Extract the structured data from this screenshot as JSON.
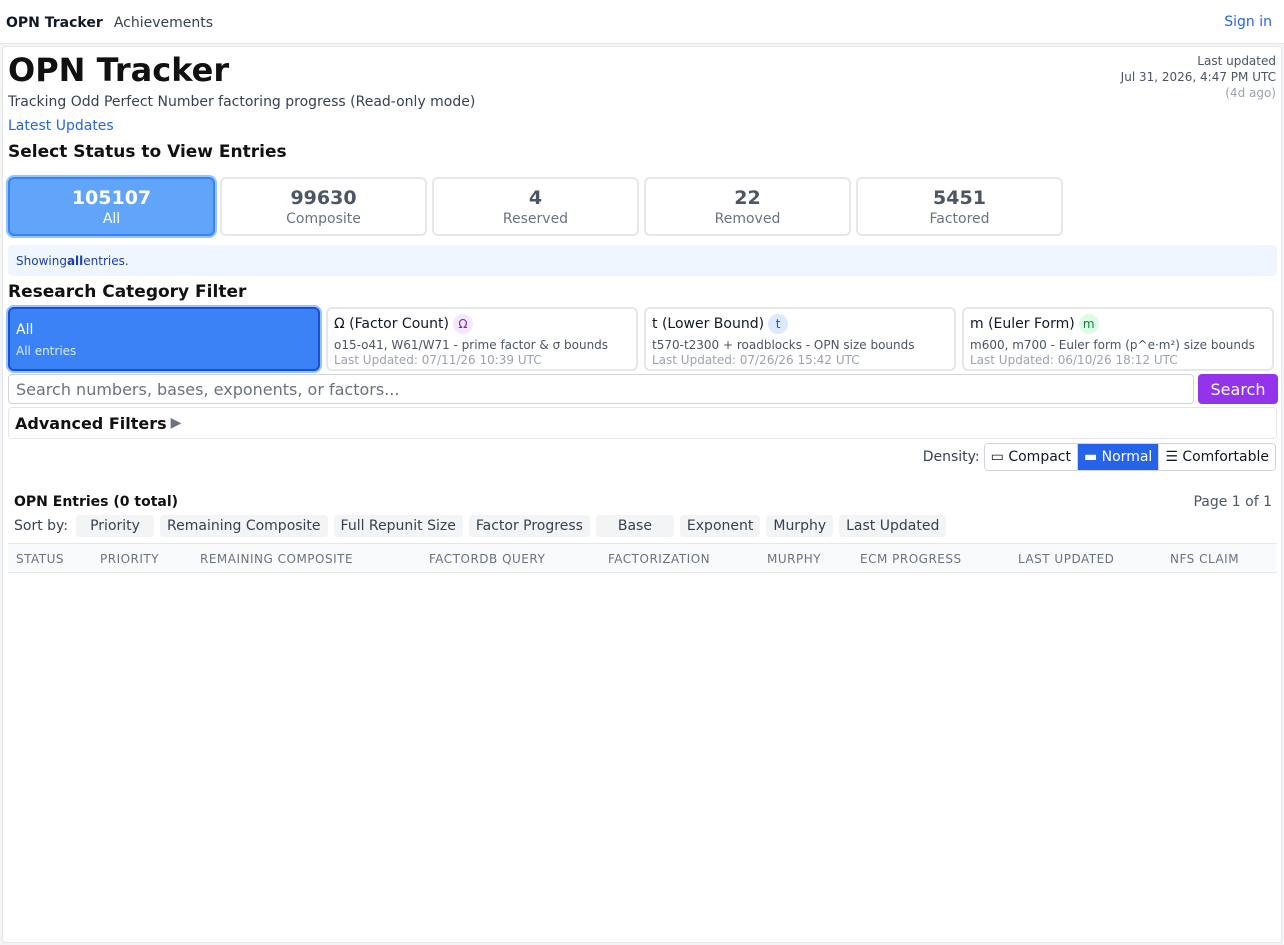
{
  "topbar": {
    "brand": "OPN Tracker",
    "nav_achievements": "Achievements",
    "signin": "Sign in"
  },
  "header": {
    "title": "OPN Tracker",
    "subtitle": "Tracking Odd Perfect Number factoring progress  (Read-only mode)",
    "latest_updates": "Latest Updates",
    "last_updated_label": "Last updated",
    "last_updated_value": "Jul 31, 2026, 4:47 PM UTC",
    "last_updated_ago": "(4d ago)"
  },
  "status": {
    "heading": "Select Status to View Entries",
    "cards": [
      {
        "count": "105107",
        "label": "All"
      },
      {
        "count": "99630",
        "label": "Composite"
      },
      {
        "count": "4",
        "label": "Reserved"
      },
      {
        "count": "22",
        "label": "Removed"
      },
      {
        "count": "5451",
        "label": "Factored"
      }
    ],
    "showing_prefix": "Showing ",
    "showing_value": "all",
    "showing_suffix": " entries."
  },
  "category": {
    "heading": "Research Category Filter",
    "cards": [
      {
        "title": "All",
        "desc": "All entries"
      },
      {
        "title": "Ω (Factor Count)",
        "badge": "Ω",
        "desc": "o15-o41, W61/W71 - prime factor & σ bounds",
        "updated": "Last Updated: 07/11/26 10:39 UTC"
      },
      {
        "title": "t (Lower Bound)",
        "badge": "t",
        "desc": "t570-t2300 + roadblocks - OPN size bounds",
        "updated": "Last Updated: 07/26/26 15:42 UTC"
      },
      {
        "title": "m (Euler Form)",
        "badge": "m",
        "desc": "m600, m700 - Euler form (p^e·m²) size bounds",
        "updated": "Last Updated: 06/10/26 18:12 UTC"
      }
    ]
  },
  "search": {
    "placeholder": "Search numbers, bases, exponents, or factors...",
    "button": "Search"
  },
  "advanced": {
    "label": "Advanced Filters",
    "arrow": "▶"
  },
  "density": {
    "label": "Density:",
    "options": [
      "▭ Compact",
      "▬ Normal",
      "☰ Comfortable"
    ],
    "selected": "▬ Normal"
  },
  "entries": {
    "heading": "OPN Entries (0 total)",
    "page_info": "Page 1 of 1",
    "sort_label": "Sort by:",
    "sort_options": [
      "Priority",
      "Remaining Composite",
      "Full Repunit Size",
      "Factor Progress",
      "Base",
      "Exponent",
      "Murphy",
      "Last Updated"
    ],
    "columns": [
      "STATUS",
      "PRIORITY",
      "REMAINING COMPOSITE",
      "FACTORDB QUERY",
      "FACTORIZATION",
      "MURPHY",
      "ECM PROGRESS",
      "LAST UPDATED",
      "NFS CLAIM"
    ]
  }
}
